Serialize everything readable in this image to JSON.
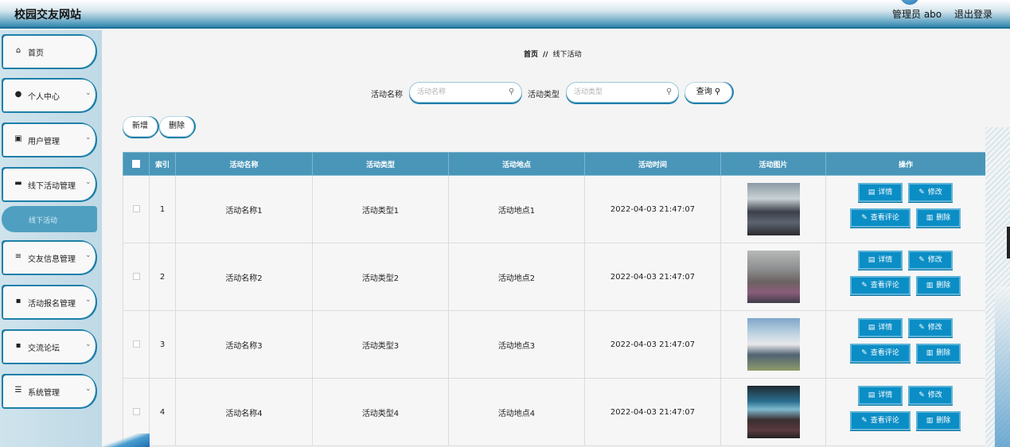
{
  "header": {
    "site_title": "校园交友网站",
    "user_label": "管理员 abo",
    "logout_label": "退出登录"
  },
  "sidebar": {
    "items": [
      {
        "label": "首页",
        "icon": "home-icon",
        "glyph": "⌂",
        "chevron": ""
      },
      {
        "label": "个人中心",
        "icon": "user-icon",
        "glyph": "●",
        "chevron": "⌄"
      },
      {
        "label": "用户管理",
        "icon": "clipboard-icon",
        "glyph": "▣",
        "chevron": "⌄"
      },
      {
        "label": "线下活动管理",
        "icon": "briefcase-icon",
        "glyph": "▬",
        "chevron": "⌄"
      },
      {
        "label": "交友信息管理",
        "icon": "list-icon",
        "glyph": "≡",
        "chevron": "⌄"
      },
      {
        "label": "活动报名管理",
        "icon": "grid-icon",
        "glyph": "▪",
        "chevron": "⌄"
      },
      {
        "label": "交流论坛",
        "icon": "grid-icon",
        "glyph": "▪",
        "chevron": "⌄"
      },
      {
        "label": "系统管理",
        "icon": "sliders-icon",
        "glyph": "☰",
        "chevron": "⌄"
      }
    ],
    "sub_item": "线下活动"
  },
  "breadcrumb": {
    "home": "首页",
    "separator": "//",
    "current": "线下活动"
  },
  "search": {
    "name_label": "活动名称",
    "name_placeholder": "活动名称",
    "type_label": "活动类型",
    "type_placeholder": "活动类型",
    "query_label": "查询"
  },
  "toolbar": {
    "add_label": "新增",
    "delete_label": "删除"
  },
  "table": {
    "headers": [
      "索引",
      "活动名称",
      "活动类型",
      "活动地点",
      "活动时间",
      "活动图片",
      "操作"
    ],
    "rows": [
      {
        "index": "1",
        "name": "活动名称1",
        "type": "活动类型1",
        "place": "活动地点1",
        "time": "2022-04-03 21:47:07"
      },
      {
        "index": "2",
        "name": "活动名称2",
        "type": "活动类型2",
        "place": "活动地点2",
        "time": "2022-04-03 21:47:07"
      },
      {
        "index": "3",
        "name": "活动名称3",
        "type": "活动类型3",
        "place": "活动地点3",
        "time": "2022-04-03 21:47:07"
      },
      {
        "index": "4",
        "name": "活动名称4",
        "type": "活动类型4",
        "place": "活动地点4",
        "time": "2022-04-03 21:47:07"
      }
    ],
    "actions": {
      "detail": "详情",
      "edit": "修改",
      "comments": "查看评论",
      "delete": "删除"
    }
  },
  "colors": {
    "accent": "#1e7fa9",
    "header_cell": "#4996b9",
    "action_button": "#0b8ec6"
  }
}
